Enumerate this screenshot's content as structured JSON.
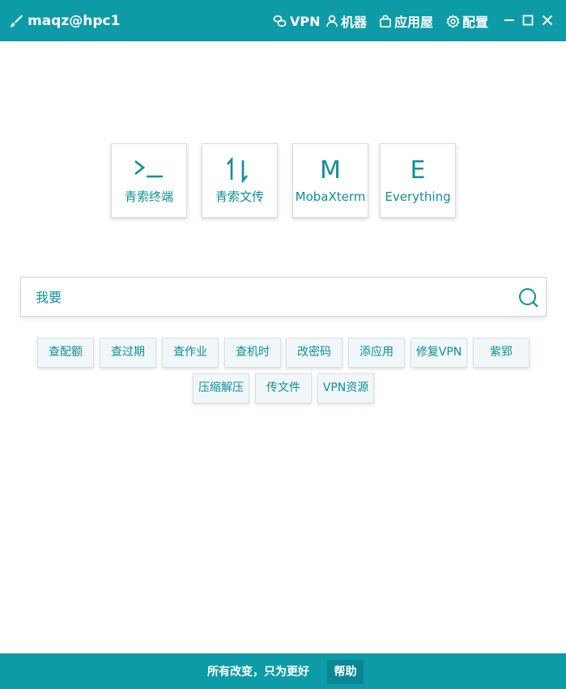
{
  "titlebar": {
    "user_host": "maqz@hpc1",
    "nav": [
      {
        "icon": "link-icon",
        "label": "VPN"
      },
      {
        "icon": "user-icon",
        "label": "机器"
      },
      {
        "icon": "bag-icon",
        "label": "应用屋"
      },
      {
        "icon": "gear-icon",
        "label": "配置"
      }
    ]
  },
  "tiles": [
    {
      "icon": "terminal-icon",
      "label": "青索终端"
    },
    {
      "icon": "transfer-icon",
      "label": "青索文传"
    },
    {
      "glyph": "M",
      "label": "MobaXterm"
    },
    {
      "glyph": "E",
      "label": "Everything"
    }
  ],
  "search": {
    "placeholder": "我要",
    "value": ""
  },
  "chips_row1": [
    "查配额",
    "查过期",
    "查作业",
    "查机时",
    "改密码",
    "添应用",
    "修复VPN",
    "紫郢"
  ],
  "chips_row2": [
    "压缩解压",
    "传文件",
    "VPN资源"
  ],
  "footer": {
    "text": "所有改变，只为更好",
    "help_label": "帮助"
  },
  "colors": {
    "accent": "#0e9ba8",
    "text": "#0e8f9a",
    "chip_bg": "#f1f7f8"
  }
}
